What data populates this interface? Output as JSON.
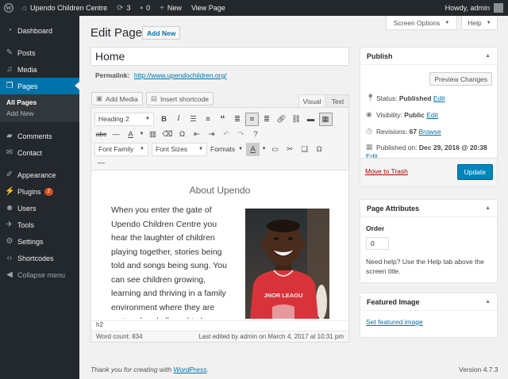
{
  "adminbar": {
    "site_name": "Upendo Children Centre",
    "updates_count": "3",
    "comments_count": "0",
    "new_label": "New",
    "view_page_label": "View Page",
    "howdy": "Howdy, admin"
  },
  "sidebar": {
    "items": [
      {
        "label": "Dashboard",
        "icon": "dashboard-icon"
      },
      {
        "label": "Posts",
        "icon": "pin-icon"
      },
      {
        "label": "Media",
        "icon": "media-icon"
      },
      {
        "label": "Pages",
        "icon": "pages-icon"
      },
      {
        "label": "Comments",
        "icon": "comments-icon"
      },
      {
        "label": "Contact",
        "icon": "envelope-icon"
      },
      {
        "label": "Appearance",
        "icon": "brush-icon"
      },
      {
        "label": "Plugins",
        "icon": "plug-icon",
        "badge": "2"
      },
      {
        "label": "Users",
        "icon": "users-icon"
      },
      {
        "label": "Tools",
        "icon": "wrench-icon"
      },
      {
        "label": "Settings",
        "icon": "settings-icon"
      },
      {
        "label": "Shortcodes",
        "icon": "code-icon"
      },
      {
        "label": "Collapse menu",
        "icon": "collapse-icon"
      }
    ],
    "submenu": {
      "all_pages": "All Pages",
      "add_new": "Add New"
    }
  },
  "screen_meta": {
    "screen_options": "Screen Options",
    "help": "Help"
  },
  "page": {
    "title": "Edit Page",
    "add_new": "Add New"
  },
  "post_title": "Home",
  "permalink": {
    "label": "Permalink:",
    "url": "http://www.upendochildren.org/"
  },
  "media": {
    "add_media": "Add Media",
    "insert_shortcode": "Insert shortcode"
  },
  "editor_tabs": {
    "visual": "Visual",
    "text": "Text"
  },
  "toolbar": {
    "format_select": "Heading 2",
    "font_family": "Font Family",
    "font_sizes": "Font Sizes",
    "formats": "Formats"
  },
  "content": {
    "heading": "About Upendo",
    "paragraph": "When you enter the gate of Upendo Children Centre you hear the laughter of children playing together, stories being told and songs being sung. You can see children growing, learning and thriving in a family environment where they are nurtured and allowed to be children again.",
    "photo_shirt_text": "JNOR LEAGU"
  },
  "status": {
    "path": "h2",
    "word_count": "Word count: 834",
    "last_edited": "Last edited by admin on March 4, 2017 at 10:31 pm"
  },
  "publish": {
    "title": "Publish",
    "preview": "Preview Changes",
    "status_label": "Status:",
    "status_value": "Published",
    "visibility_label": "Visibility:",
    "visibility_value": "Public",
    "revisions_label": "Revisions:",
    "revisions_value": "67",
    "browse": "Browse",
    "published_on_label": "Published on:",
    "published_on_value": "Dec 29, 2016 @ 20:38",
    "edit": "Edit",
    "trash": "Move to Trash",
    "update": "Update"
  },
  "page_attributes": {
    "title": "Page Attributes",
    "order_label": "Order",
    "order_value": "0",
    "help_text": "Need help? Use the Help tab above the screen title."
  },
  "featured_image": {
    "title": "Featured Image",
    "link": "Set featured image"
  },
  "footer": {
    "thanks_prefix": "Thank you for creating with ",
    "wordpress": "WordPress",
    "thanks_suffix": ".",
    "version": "Version 4.7.3"
  },
  "colors": {
    "accent": "#0073aa",
    "sidebar_bg": "#23282d",
    "update_button": "#0085ba",
    "trash": "#aa0000"
  }
}
